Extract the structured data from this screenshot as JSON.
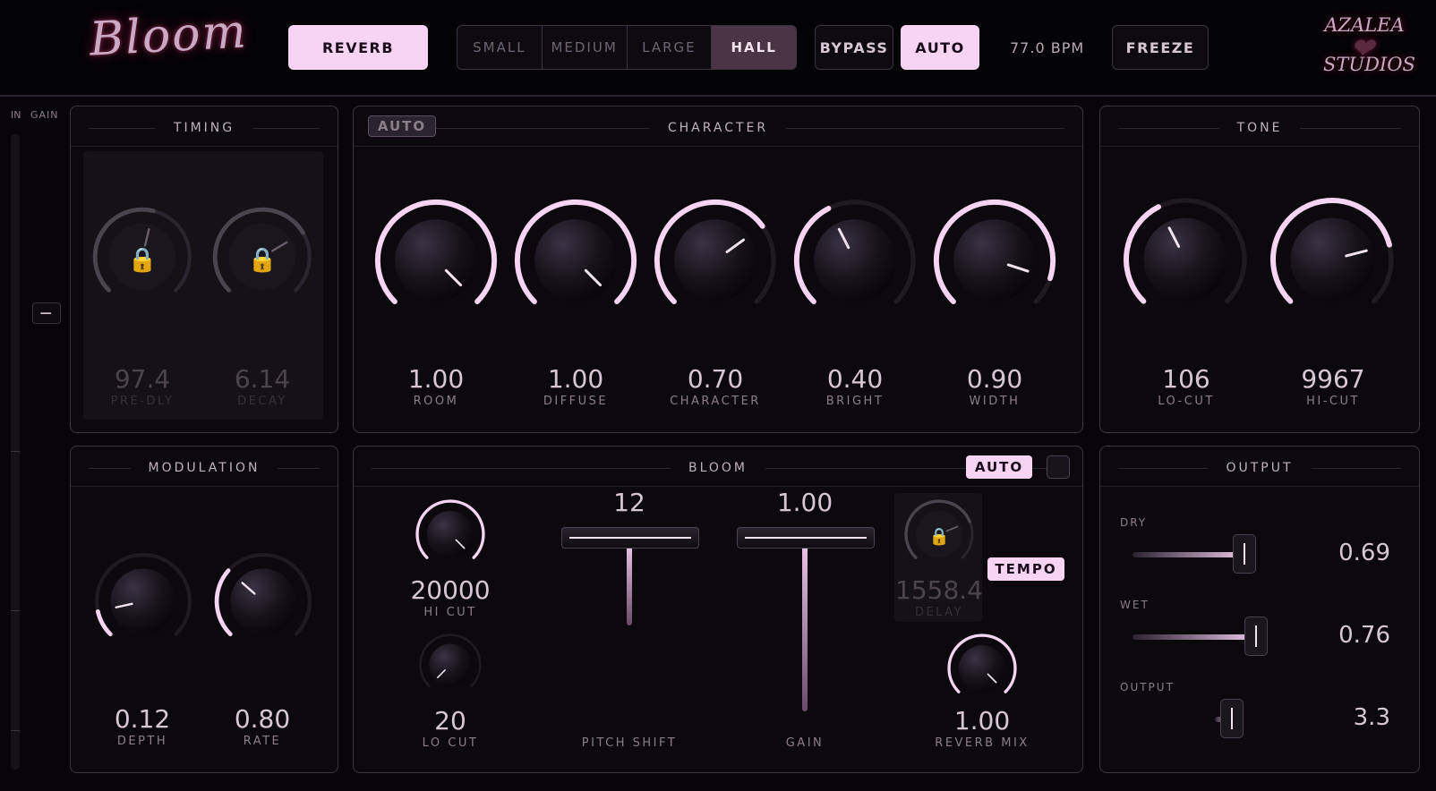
{
  "header": {
    "logo": "Bloom",
    "brand_line1": "AZALEA",
    "brand_line2": "STUDIOS",
    "mode_button": "REVERB",
    "sizes": [
      "SMALL",
      "MEDIUM",
      "LARGE",
      "HALL"
    ],
    "selected_size": "HALL",
    "bypass": "BYPASS",
    "auto": "AUTO",
    "bpm": "77.0 BPM",
    "freeze": "FREEZE"
  },
  "input": {
    "in_label": "IN",
    "gain_label": "GAIN",
    "gain_button": "—"
  },
  "timing": {
    "title": "TIMING",
    "knobs": [
      {
        "value": "97.4",
        "label": "PRE-DLY",
        "level": 0.55,
        "locked": true
      },
      {
        "value": "6.14",
        "label": "DECAY",
        "level": 0.72,
        "locked": true
      }
    ]
  },
  "character": {
    "title": "CHARACTER",
    "auto": "AUTO",
    "knobs": [
      {
        "value": "1.00",
        "label": "ROOM",
        "level": 1.0
      },
      {
        "value": "1.00",
        "label": "DIFFUSE",
        "level": 1.0
      },
      {
        "value": "0.70",
        "label": "CHARACTER",
        "level": 0.7
      },
      {
        "value": "0.40",
        "label": "BRIGHT",
        "level": 0.4
      },
      {
        "value": "0.90",
        "label": "WIDTH",
        "level": 0.9
      }
    ]
  },
  "tone": {
    "title": "TONE",
    "knobs": [
      {
        "value": "106",
        "label": "LO-CUT",
        "level": 0.4
      },
      {
        "value": "9967",
        "label": "HI-CUT",
        "level": 0.78
      }
    ]
  },
  "modulation": {
    "title": "MODULATION",
    "knobs": [
      {
        "value": "0.12",
        "label": "DEPTH",
        "level": 0.12
      },
      {
        "value": "0.80",
        "label": "RATE",
        "level": 0.32
      }
    ]
  },
  "bloom": {
    "title": "BLOOM",
    "auto": "AUTO",
    "tempo": "TEMPO",
    "hi_cut": {
      "value": "20000",
      "label": "HI CUT",
      "level": 1.0
    },
    "lo_cut": {
      "value": "20",
      "label": "LO CUT",
      "level": 0.0
    },
    "pitch_shift": {
      "value": "12",
      "label": "PITCH SHIFT",
      "level": 0.45
    },
    "gain": {
      "value": "1.00",
      "label": "GAIN",
      "level": 1.0
    },
    "delay": {
      "value": "1558.4",
      "label": "DELAY",
      "level": 0.75,
      "locked": true
    },
    "reverb_mix": {
      "value": "1.00",
      "label": "REVERB MIX",
      "level": 1.0
    }
  },
  "output": {
    "title": "OUTPUT",
    "dry": {
      "label": "DRY",
      "value": "0.69",
      "level": 0.69
    },
    "wet": {
      "label": "WET",
      "value": "0.76",
      "level": 0.76
    },
    "out": {
      "label": "OUTPUT",
      "value": "3.3",
      "level": 0.1
    }
  },
  "colors": {
    "accent": "#f6d4f2",
    "panel": "#0b090e",
    "border": "#3d3542"
  }
}
